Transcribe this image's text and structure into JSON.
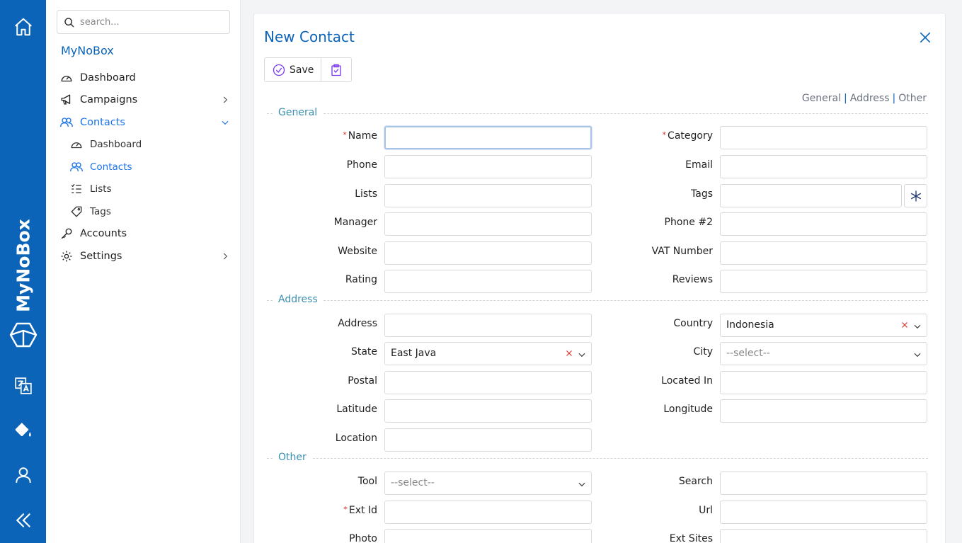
{
  "rail": {
    "brand": "MyNoBox",
    "icons": [
      "home-icon",
      "box-logo-icon",
      "translate-icon",
      "paint-bucket-icon",
      "user-icon",
      "collapse-icon"
    ]
  },
  "sidebar": {
    "search_placeholder": "search...",
    "app_title": "MyNoBox",
    "items": [
      {
        "label": "Dashboard",
        "icon": "gauge-icon"
      },
      {
        "label": "Campaigns",
        "icon": "megaphone-icon"
      },
      {
        "label": "Contacts",
        "icon": "users-icon"
      },
      {
        "label": "Dashboard",
        "icon": "gauge-icon"
      },
      {
        "label": "Contacts",
        "icon": "users-icon"
      },
      {
        "label": "Lists",
        "icon": "list-icon"
      },
      {
        "label": "Tags",
        "icon": "tag-icon"
      },
      {
        "label": "Accounts",
        "icon": "key-icon"
      },
      {
        "label": "Settings",
        "icon": "gear-icon"
      }
    ]
  },
  "panel": {
    "title": "New Contact",
    "save_label": "Save",
    "section_links": [
      "General",
      "Address",
      "Other"
    ],
    "sections": {
      "general": "General",
      "address": "Address",
      "other": "Other"
    },
    "fields": {
      "name": "Name",
      "category": "Category",
      "phone": "Phone",
      "email": "Email",
      "lists": "Lists",
      "tags": "Tags",
      "manager": "Manager",
      "phone2": "Phone #2",
      "website": "Website",
      "vat": "VAT Number",
      "rating": "Rating",
      "reviews": "Reviews",
      "address": "Address",
      "country": "Country",
      "state": "State",
      "city": "City",
      "postal": "Postal",
      "located_in": "Located In",
      "latitude": "Latitude",
      "longitude": "Longitude",
      "location": "Location",
      "tool": "Tool",
      "search": "Search",
      "ext_id": "Ext Id",
      "url": "Url",
      "photo": "Photo",
      "ext_sites": "Ext Sites"
    },
    "values": {
      "country": "Indonesia",
      "state": "East Java",
      "city": "--select--",
      "tool": "--select--"
    },
    "required_mark": "*"
  }
}
